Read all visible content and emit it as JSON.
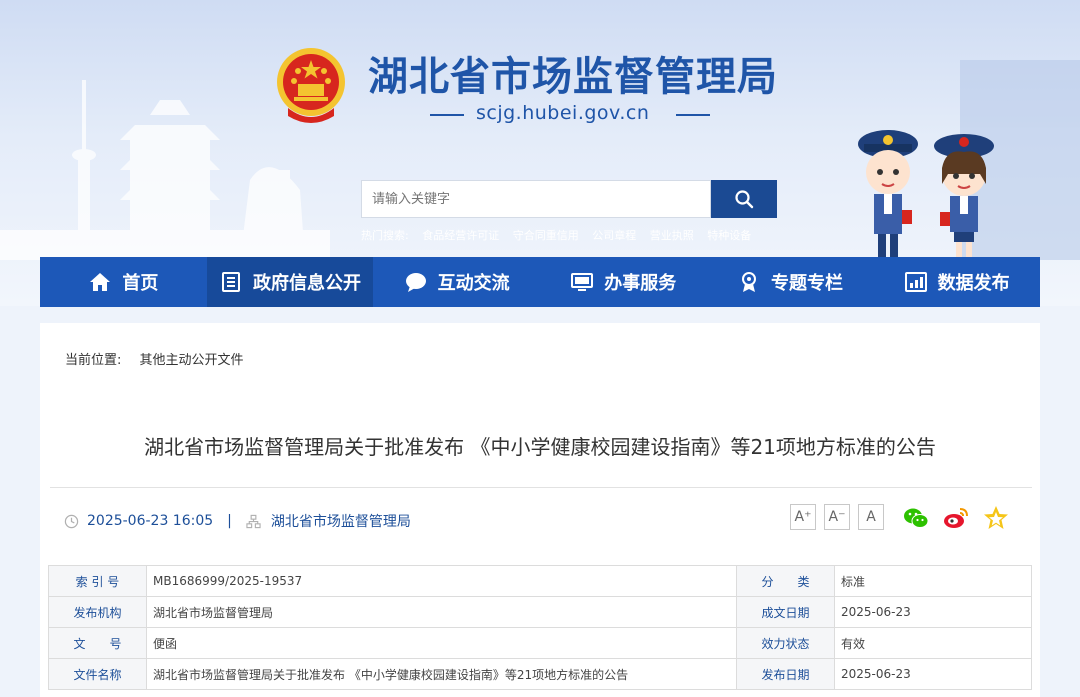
{
  "header": {
    "site_title": "湖北省市场监督管理局",
    "domain": "scjg.hubei.gov.cn"
  },
  "search": {
    "placeholder": "请输入关键字",
    "hot_label": "热门搜索:",
    "hot_terms": [
      "食品经营许可证",
      "守合同重信用",
      "公司章程",
      "营业执照",
      "特种设备"
    ]
  },
  "nav": {
    "items": [
      {
        "label": "首页",
        "icon": "home-icon"
      },
      {
        "label": "政府信息公开",
        "icon": "document-list-icon"
      },
      {
        "label": "互动交流",
        "icon": "chat-bubble-icon"
      },
      {
        "label": "办事服务",
        "icon": "monitor-icon"
      },
      {
        "label": "专题专栏",
        "icon": "badge-icon"
      },
      {
        "label": "数据发布",
        "icon": "bar-chart-icon"
      }
    ],
    "active_index": 1
  },
  "breadcrumb": {
    "label": "当前位置:",
    "current": "其他主动公开文件"
  },
  "article": {
    "title": "湖北省市场监督管理局关于批准发布 《中小学健康校园建设指南》等21项地方标准的公告",
    "datetime": "2025-06-23 16:05",
    "separator": "|",
    "source": "湖北省市场监督管理局"
  },
  "font_controls": [
    "A⁺",
    "A⁻",
    "A"
  ],
  "info_table": {
    "rows": [
      {
        "label1": "索 引 号",
        "value1": "MB1686999/2025-19537",
        "label2": "分　　类",
        "value2": "标准"
      },
      {
        "label1": "发布机构",
        "value1": "湖北省市场监督管理局",
        "label2": "成文日期",
        "value2": "2025-06-23"
      },
      {
        "label1": "文　　号",
        "value1": "便函",
        "label2": "效力状态",
        "value2": "有效"
      },
      {
        "label1": "文件名称",
        "value1": "湖北省市场监督管理局关于批准发布 《中小学健康校园建设指南》等21项地方标准的公告",
        "label2": "发布日期",
        "value2": "2025-06-23"
      }
    ]
  },
  "colors": {
    "brand_blue": "#1f55a8",
    "nav_blue": "#1d58b8",
    "nav_active": "#174a9a",
    "emblem_red": "#d7261e",
    "emblem_gold": "#f4c430"
  }
}
